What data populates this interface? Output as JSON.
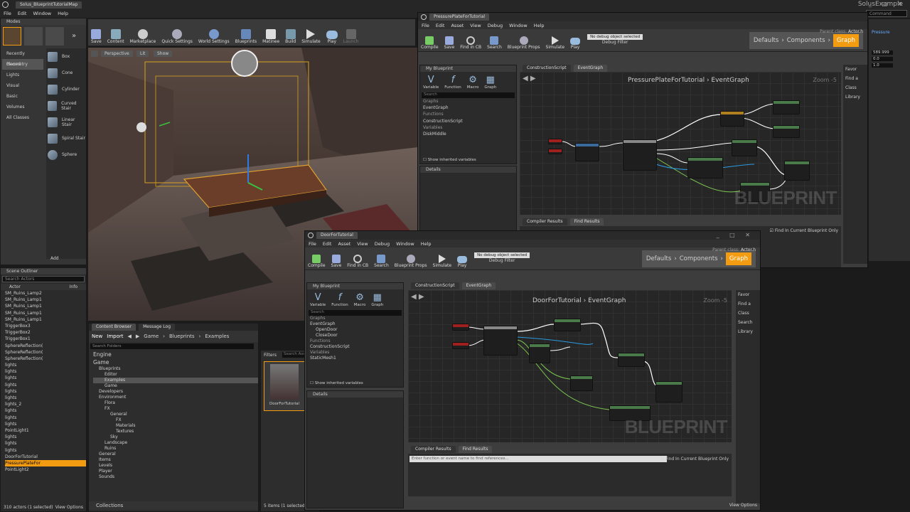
{
  "main_window": {
    "title_tab": "Solus_BlueprintTutorialMap",
    "app_title": "SolusExample",
    "search_placeholder": "Command"
  },
  "menu": [
    "File",
    "Edit",
    "Window",
    "Help"
  ],
  "modes": {
    "tab": "Modes",
    "categories": [
      "Recently Placed",
      "Geometry",
      "Lights",
      "Visual",
      "Basic",
      "Volumes",
      "All Classes"
    ],
    "items": [
      "Box",
      "Cone",
      "Cylinder",
      "Curved Stair",
      "Linear Stair",
      "Spiral Stair",
      "Sphere"
    ],
    "add_label": "Add"
  },
  "toolbar": [
    "Save",
    "Content",
    "Marketplace",
    "Quick Settings",
    "World Settings",
    "Blueprints",
    "Matinee",
    "Build",
    "Simulate",
    "Play",
    "Launch"
  ],
  "viewport": {
    "perspective": "Perspective",
    "lit": "Lit",
    "show": "Show"
  },
  "outliner": {
    "tab": "Scene Outliner",
    "search_placeholder": "Search Actors",
    "col_actor": "Actor",
    "col_info": "Info",
    "rows": [
      "SM_Ruins_Lamp2",
      "SM_Ruins_Lamp1",
      "SM_Ruins_Lamp1",
      "SM_Ruins_Lamp1",
      "SM_Ruins_Lamp1",
      "TriggerBox3",
      "TriggerBox2",
      "TriggerBox1",
      "SphereReflection(",
      "SphereReflection(",
      "SphereReflection(",
      "lights",
      "lights",
      "lights",
      "lights",
      "lights",
      "lights",
      "lights_2",
      "lights",
      "lights",
      "lights",
      "PointLight1",
      "lights",
      "lights",
      "lights",
      "DoorForTutorial",
      "PressurePlateFor",
      "PointLight2"
    ],
    "footer": "310 actors (1 selected)",
    "view_options": "View Options"
  },
  "content_browser": {
    "tab1": "Content Browser",
    "tab2": "Message Log",
    "new": "New",
    "import": "Import",
    "path": [
      "Game",
      "Blueprints",
      "Examples"
    ],
    "search_folders": "Search Folders",
    "filters": "Filters",
    "search_assets": "Search Ass",
    "tree": [
      "Engine",
      "Game",
      "Blueprints",
      "Editor",
      "Examples",
      "Game",
      "Developers",
      "Environment",
      "Flora",
      "FX",
      "General",
      "FX",
      "Materials",
      "Textures",
      "Sky",
      "Landscape",
      "Ruins",
      "General",
      "Items",
      "Levels",
      "Player",
      "Sounds"
    ],
    "asset": "DoorForTutorial",
    "footer": "5 items (1 selected)",
    "collections": "Collections",
    "view_options": "View Options"
  },
  "bp1": {
    "tab": "PressurePlateForTutorial",
    "parent_class": "Parent class:",
    "parent_value": "Actor.h",
    "menu": [
      "File",
      "Edit",
      "Asset",
      "View",
      "Debug",
      "Window",
      "Help"
    ],
    "toolbar": [
      "Compile",
      "Save",
      "Find in CB",
      "Search",
      "Blueprint Props",
      "Simulate",
      "Play"
    ],
    "debug_select": "No debug object selected",
    "debug_filter": "Debug Filter",
    "modes": [
      "Defaults",
      "Components",
      "Graph"
    ],
    "my_blueprint": "My Blueprint",
    "actions": [
      "Variable",
      "Function",
      "Macro",
      "Graph"
    ],
    "search": "Search",
    "items": [
      "Graphs",
      "EventGraph",
      "Functions",
      "ConstructionScript",
      "Variables",
      "DiskMiddle"
    ],
    "show_inherited": "Show inherited variables",
    "details": "Details",
    "graph_tabs": [
      "ConstructionScript",
      "EventGraph"
    ],
    "breadcrumb": [
      "PressurePlateForTutorial",
      "EventGraph"
    ],
    "zoom": "Zoom -5",
    "watermark": "BLUEPRINT",
    "bottom_tabs": [
      "Compiler Results",
      "Find Results"
    ],
    "find_current": "Find In Current Blueprint Only",
    "right_labels": [
      "Favor",
      "Find a",
      "Class",
      "Library"
    ],
    "values": [
      "589.999",
      "0.0",
      "1.0"
    ]
  },
  "bp2": {
    "tab": "DoorForTutorial",
    "parent_class": "Parent class:",
    "parent_value": "Actor.h",
    "menu": [
      "File",
      "Edit",
      "Asset",
      "View",
      "Debug",
      "Window",
      "Help"
    ],
    "toolbar": [
      "Compile",
      "Save",
      "Find in CB",
      "Search",
      "Blueprint Props",
      "Simulate",
      "Play"
    ],
    "debug_select": "No debug object selected",
    "debug_filter": "Debug Filter",
    "modes": [
      "Defaults",
      "Components",
      "Graph"
    ],
    "my_blueprint": "My Blueprint",
    "actions": [
      "Variable",
      "Function",
      "Macro",
      "Graph"
    ],
    "search": "Search",
    "items": [
      "Graphs",
      "EventGraph",
      "OpenDoor",
      "CloseDoor",
      "Functions",
      "ConstructionScript",
      "Variables",
      "StaticMesh1"
    ],
    "show_inherited": "Show inherited variables",
    "details": "Details",
    "graph_tabs": [
      "ConstructionScript",
      "EventGraph"
    ],
    "breadcrumb": [
      "DoorForTutorial",
      "EventGraph"
    ],
    "zoom": "Zoom -5",
    "watermark": "BLUEPRINT",
    "bottom_tabs": [
      "Compiler Results",
      "Find Results"
    ],
    "find_placeholder": "Enter function or event name to find references...",
    "find_current": "Find In Current Blueprint Only",
    "right_labels": [
      "Favor",
      "Find a",
      "Class",
      "Search",
      "Library"
    ],
    "view_options": "View Options"
  },
  "colors": {
    "accent": "#f39c12",
    "exec": "#ffffff",
    "bool": "#8b0000",
    "float": "#7ec850",
    "object": "#2b9be3"
  }
}
